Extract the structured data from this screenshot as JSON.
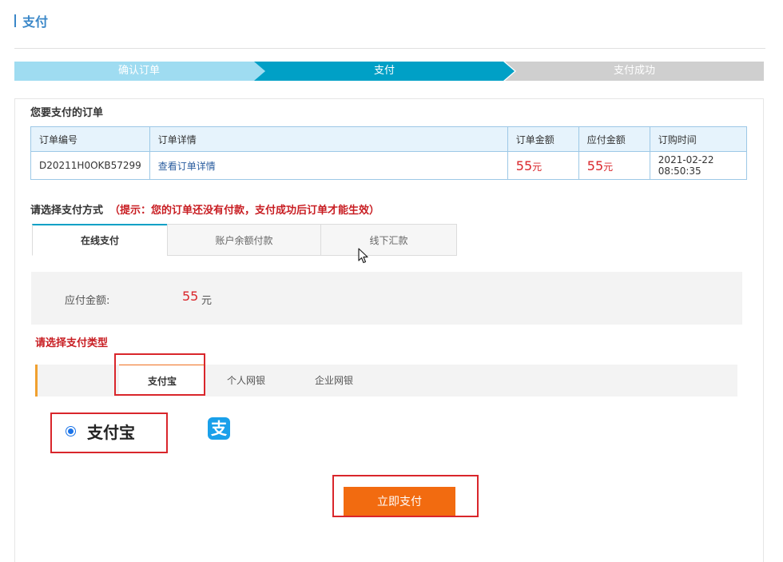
{
  "page": {
    "title": "支付"
  },
  "steps": [
    "确认订单",
    "支付",
    "支付成功"
  ],
  "order_section": {
    "label": "您要支付的订单",
    "headers": [
      "订单编号",
      "订单详情",
      "订单金额",
      "应付金额",
      "订购时间"
    ],
    "row": {
      "order_no": "D20211H0OKB57299",
      "detail_link": "查看订单详情",
      "order_amount": "55",
      "order_amount_unit": "元",
      "payable_amount": "55",
      "payable_amount_unit": "元",
      "order_time": "2021-02-22 08:50:35"
    }
  },
  "method_section": {
    "label": "请选择支付方式",
    "hint": "（提示：您的订单还没有付款，支付成功后订单才能生效）",
    "tabs": [
      "在线支付",
      "账户余额付款",
      "线下汇款"
    ],
    "active_tab_index": 0
  },
  "amount": {
    "label": "应付金额:",
    "value": "55",
    "unit": "元"
  },
  "type_section": {
    "label": "请选择支付类型",
    "types": [
      "支付宝",
      "个人网银",
      "企业网银"
    ],
    "selected_type_index": 0,
    "selected_option_label": "支付宝",
    "logo_glyph": "支"
  },
  "pay_button": {
    "label": "立即支付"
  },
  "colors": {
    "accent": "#00a0c6",
    "price": "#d9262b",
    "pay_button": "#f26b10",
    "highlight_box": "#d9262b"
  },
  "icons": [
    "alipay-logo-icon",
    "mouse-cursor-icon",
    "radio-selected-icon"
  ]
}
